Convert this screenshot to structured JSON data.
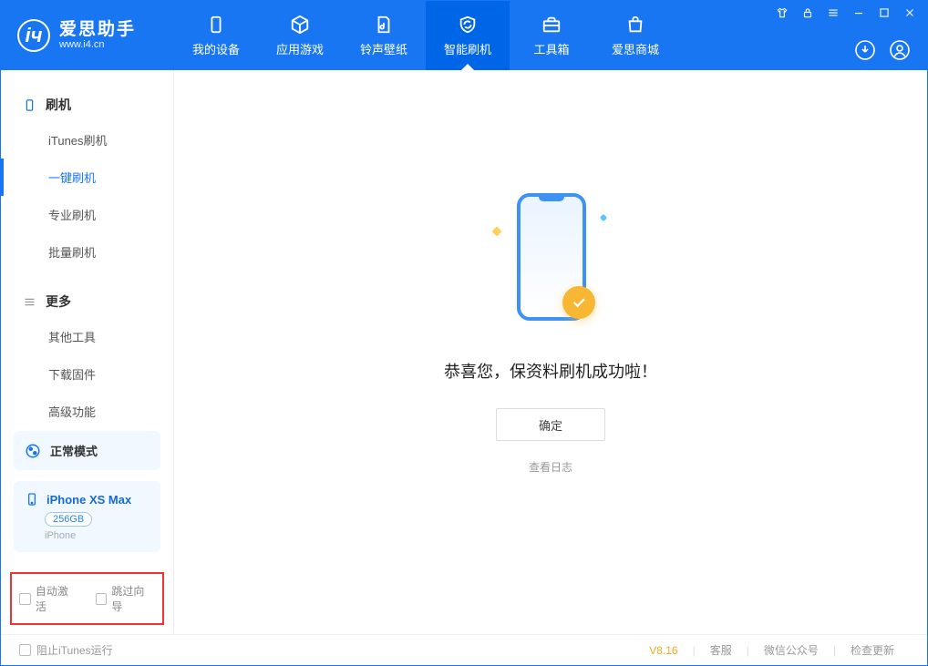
{
  "logo": {
    "cn": "爱思助手",
    "url": "www.i4.cn"
  },
  "tabs": [
    {
      "label": "我的设备"
    },
    {
      "label": "应用游戏"
    },
    {
      "label": "铃声壁纸"
    },
    {
      "label": "智能刷机"
    },
    {
      "label": "工具箱"
    },
    {
      "label": "爱思商城"
    }
  ],
  "sidebar": {
    "group1": "刷机",
    "items1": [
      "iTunes刷机",
      "一键刷机",
      "专业刷机",
      "批量刷机"
    ],
    "group2": "更多",
    "items2": [
      "其他工具",
      "下载固件",
      "高级功能"
    ]
  },
  "mode": {
    "label": "正常模式"
  },
  "device": {
    "name": "iPhone XS Max",
    "capacity": "256GB",
    "type": "iPhone"
  },
  "checks": {
    "auto_activate": "自动激活",
    "skip_guide": "跳过向导"
  },
  "main": {
    "success": "恭喜您，保资料刷机成功啦！",
    "ok": "确定",
    "view_log": "查看日志"
  },
  "footer": {
    "block_itunes": "阻止iTunes运行",
    "version": "V8.16",
    "support": "客服",
    "wechat": "微信公众号",
    "update": "检查更新"
  }
}
